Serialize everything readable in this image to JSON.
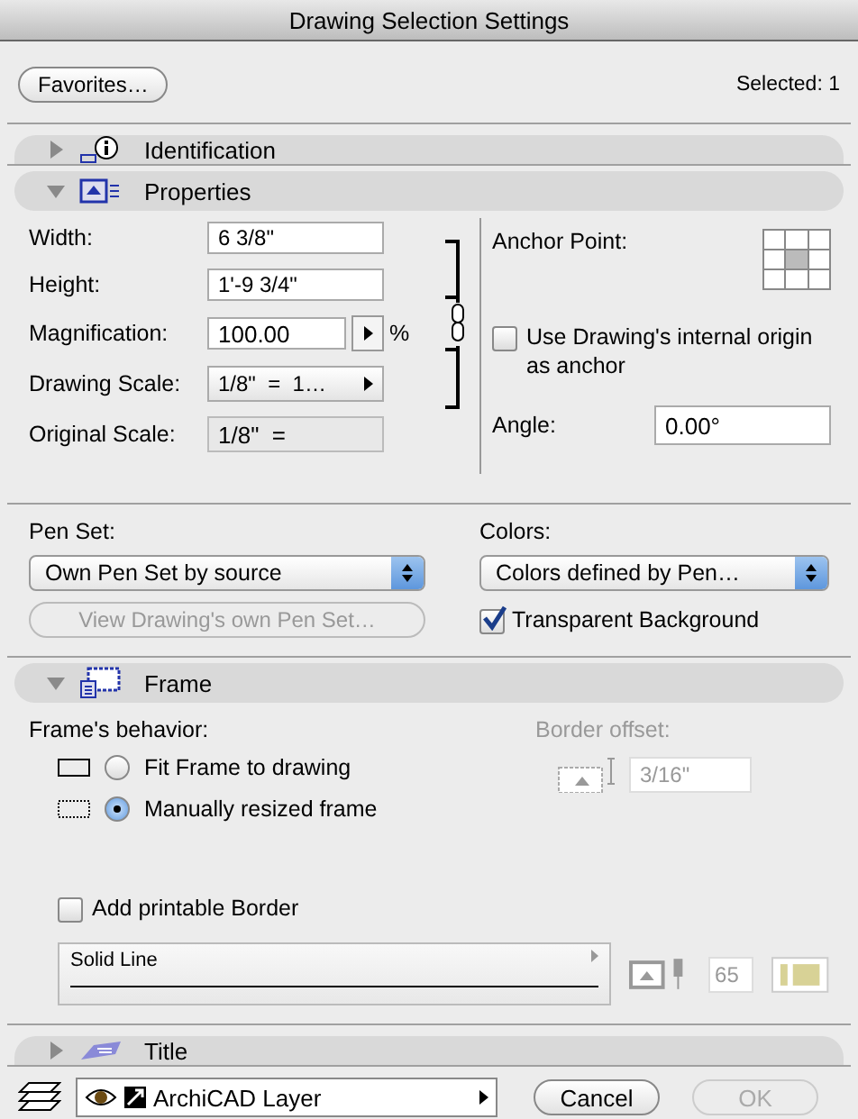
{
  "window": {
    "title": "Drawing Selection Settings"
  },
  "toolbar": {
    "favorites_button": "Favorites…",
    "selected_count": "Selected: 1"
  },
  "sections": [
    {
      "kind": "identification",
      "title": "Identification",
      "expanded": false
    },
    {
      "kind": "properties",
      "title": "Properties",
      "expanded": true
    },
    {
      "kind": "frame",
      "title": "Frame",
      "expanded": true
    },
    {
      "kind": "title",
      "title": "Title",
      "expanded": false
    }
  ],
  "properties": {
    "size_fields": [
      {
        "label": "Width:",
        "value": "6 3/8\""
      },
      {
        "label": "Height:",
        "value": "1'-9 3/4\""
      }
    ],
    "magnification": {
      "label": "Magnification:",
      "value": "100.00",
      "unit": "%"
    },
    "drawing_scale": {
      "label": "Drawing Scale:",
      "value": "1/8\"  =  1…"
    },
    "original_scale": {
      "label": "Original Scale:",
      "value": "1/8\"  ="
    },
    "anchor_point": {
      "label": "Anchor Point:"
    },
    "use_internal_origin": {
      "label": "Use Drawing's internal origin as anchor",
      "checked": false
    },
    "angle": {
      "label": "Angle:",
      "value": "0.00°"
    },
    "pen_set": {
      "label": "Pen Set:",
      "value": "Own Pen Set by source"
    },
    "view_pen_set_button": {
      "label": "View Drawing's own Pen Set…",
      "disabled": true
    },
    "colors": {
      "label": "Colors:",
      "value": "Colors defined by Pen…"
    },
    "transparent_background": {
      "label": "Transparent Background",
      "checked": true
    }
  },
  "frame": {
    "behavior_label": "Frame's behavior:",
    "behaviors": [
      {
        "label": "Fit Frame to drawing",
        "selected": false
      },
      {
        "label": "Manually resized frame",
        "selected": true
      }
    ],
    "border_offset": {
      "label": "Border offset:",
      "value": "3/16\"",
      "disabled": true
    },
    "printable_border": {
      "label": "Add printable Border",
      "checked": false
    },
    "line_type": "Solid Line",
    "pen": "65"
  },
  "footer": {
    "layer": "ArchiCAD Layer",
    "cancel_button": "Cancel",
    "ok_button": {
      "label": "OK",
      "disabled": true
    }
  }
}
